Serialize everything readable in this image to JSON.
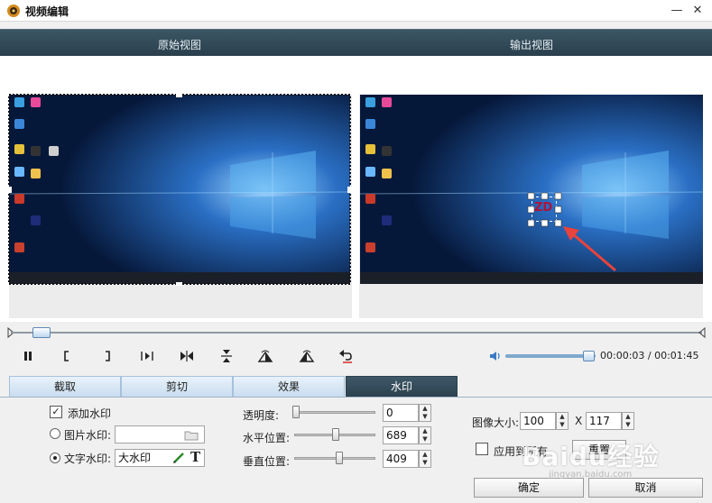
{
  "window": {
    "title": "视频编辑",
    "minimize_label": "—",
    "close_label": "✕"
  },
  "views": {
    "original_label": "原始视图",
    "output_label": "输出视图",
    "output_overlay_text": "ZD"
  },
  "playback": {
    "time": "00:00:03 / 00:01:45",
    "volume_fraction": 0.9,
    "timeline_position_fraction": 0.03
  },
  "tabs": [
    {
      "label": "截取"
    },
    {
      "label": "剪切"
    },
    {
      "label": "效果"
    },
    {
      "label": "水印"
    }
  ],
  "active_tab": "水印",
  "watermark": {
    "add_watermark_label": "添加水印",
    "add_watermark_checked": true,
    "image_watermark_label": "图片水印:",
    "image_watermark_value": "",
    "text_watermark_label": "文字水印:",
    "text_watermark_value": "大水印",
    "selected_mode": "text"
  },
  "position": {
    "opacity_label": "透明度:",
    "opacity_value": "0",
    "horizontal_label": "水平位置:",
    "horizontal_value": "689",
    "vertical_label": "垂直位置:",
    "vertical_value": "409"
  },
  "image_size": {
    "label": "图像大小:",
    "width_value": "100",
    "separator": "X",
    "height_value": "117",
    "apply_all_label": "应用到所有",
    "reset_label": "重置"
  },
  "footer": {
    "ok_label": "确定",
    "cancel_label": "取消"
  },
  "overlay_logo": {
    "text": "Baidu经验",
    "sub": "jingyan.baidu.com"
  },
  "colors": {
    "header_bg": "#2f4654",
    "active_tab_bg": "#344c5a",
    "annotation_red": "#e8433d"
  }
}
